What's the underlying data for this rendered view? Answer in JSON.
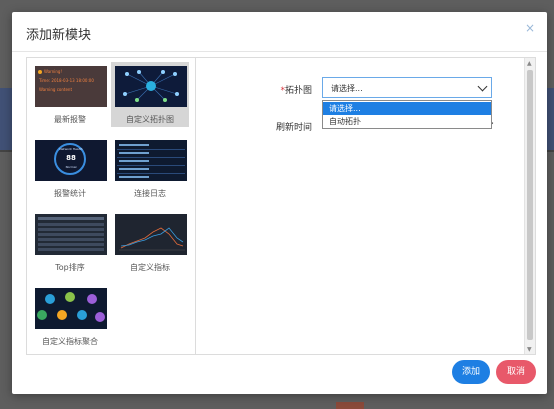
{
  "modal": {
    "title": "添加新模块",
    "close": "×"
  },
  "modules": [
    {
      "label": "最新报警",
      "thumb_lines": [
        "Warning!",
        "Time: 2018-03-13 18:00:00",
        "Warning content"
      ]
    },
    {
      "label": "自定义拓扑图",
      "selected": true
    },
    {
      "label": "报警统计",
      "gauge_title": "Network Health",
      "gauge_value": "88",
      "gauge_caption": "Normal"
    },
    {
      "label": "连接日志"
    },
    {
      "label": "Top排序"
    },
    {
      "label": "自定义指标"
    },
    {
      "label": "自定义指标聚合"
    }
  ],
  "form": {
    "topology_label_required": "*",
    "topology_label": "拓扑图",
    "refresh_label": "刷新时间",
    "select_value": "请选择...",
    "options": [
      "请选择...",
      "自动拓扑"
    ]
  },
  "buttons": {
    "add": "添加",
    "cancel": "取消"
  },
  "colors": {
    "primary": "#1e7fe3",
    "danger": "#e8596a",
    "required": "#d9363e"
  }
}
